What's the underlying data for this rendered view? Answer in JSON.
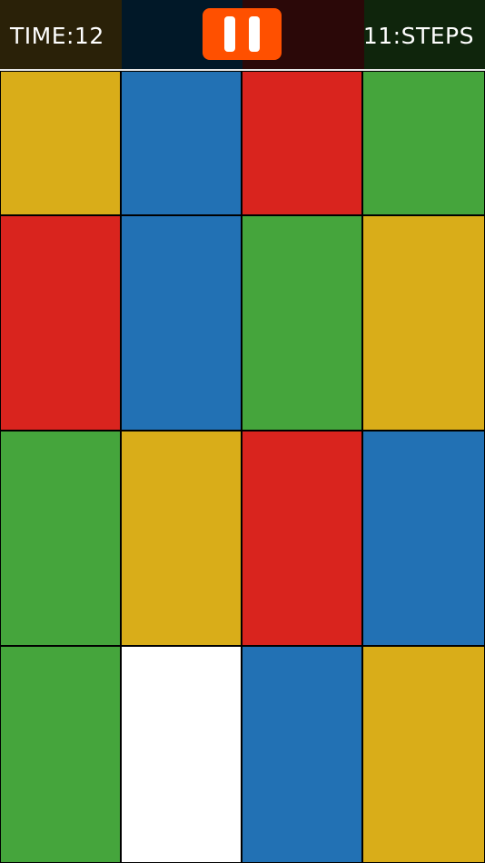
{
  "hud": {
    "time_text": "TIME:12",
    "steps_text": "11:STEPS",
    "pause_icon": "pause-icon"
  },
  "colors": {
    "yellow": "#d9ad19",
    "blue": "#2271b4",
    "red": "#d9241e",
    "green": "#45a53c",
    "white": "#ffffff",
    "pause_button": "#ff5000",
    "header_segments": [
      "#2a2108",
      "#011828",
      "#2b0808",
      "#0f250c"
    ]
  },
  "grid": {
    "rows": [
      [
        "yellow",
        "blue",
        "red",
        "green"
      ],
      [
        "red",
        "blue",
        "green",
        "yellow"
      ],
      [
        "green",
        "yellow",
        "red",
        "blue"
      ],
      [
        "green",
        "white",
        "blue",
        "yellow"
      ]
    ]
  }
}
